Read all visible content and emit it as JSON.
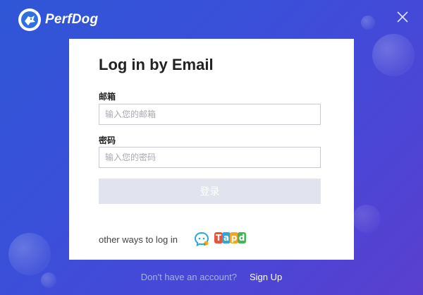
{
  "app": {
    "name": "PerfDog"
  },
  "login": {
    "title": "Log in by Email",
    "email_label": "邮箱",
    "email_placeholder": "输入您的邮箱",
    "password_label": "密码",
    "password_placeholder": "输入您的密码",
    "submit_label": "登录",
    "other_ways": "other ways to log in",
    "alt_methods": {
      "qq": "qq-icon",
      "tapd": {
        "icon": "tapd-icon",
        "letters": [
          "T",
          "a",
          "p",
          "d"
        ]
      }
    }
  },
  "footer": {
    "question": "Don't have an account?",
    "signup": "Sign Up"
  },
  "colors": {
    "background_start": "#2f56d6",
    "background_end": "#5a3fcf",
    "button_disabled": "#e1e3ee",
    "tapd_letters": [
      "#e8533a",
      "#2aa6e0",
      "#f5a623",
      "#48b35f"
    ]
  }
}
